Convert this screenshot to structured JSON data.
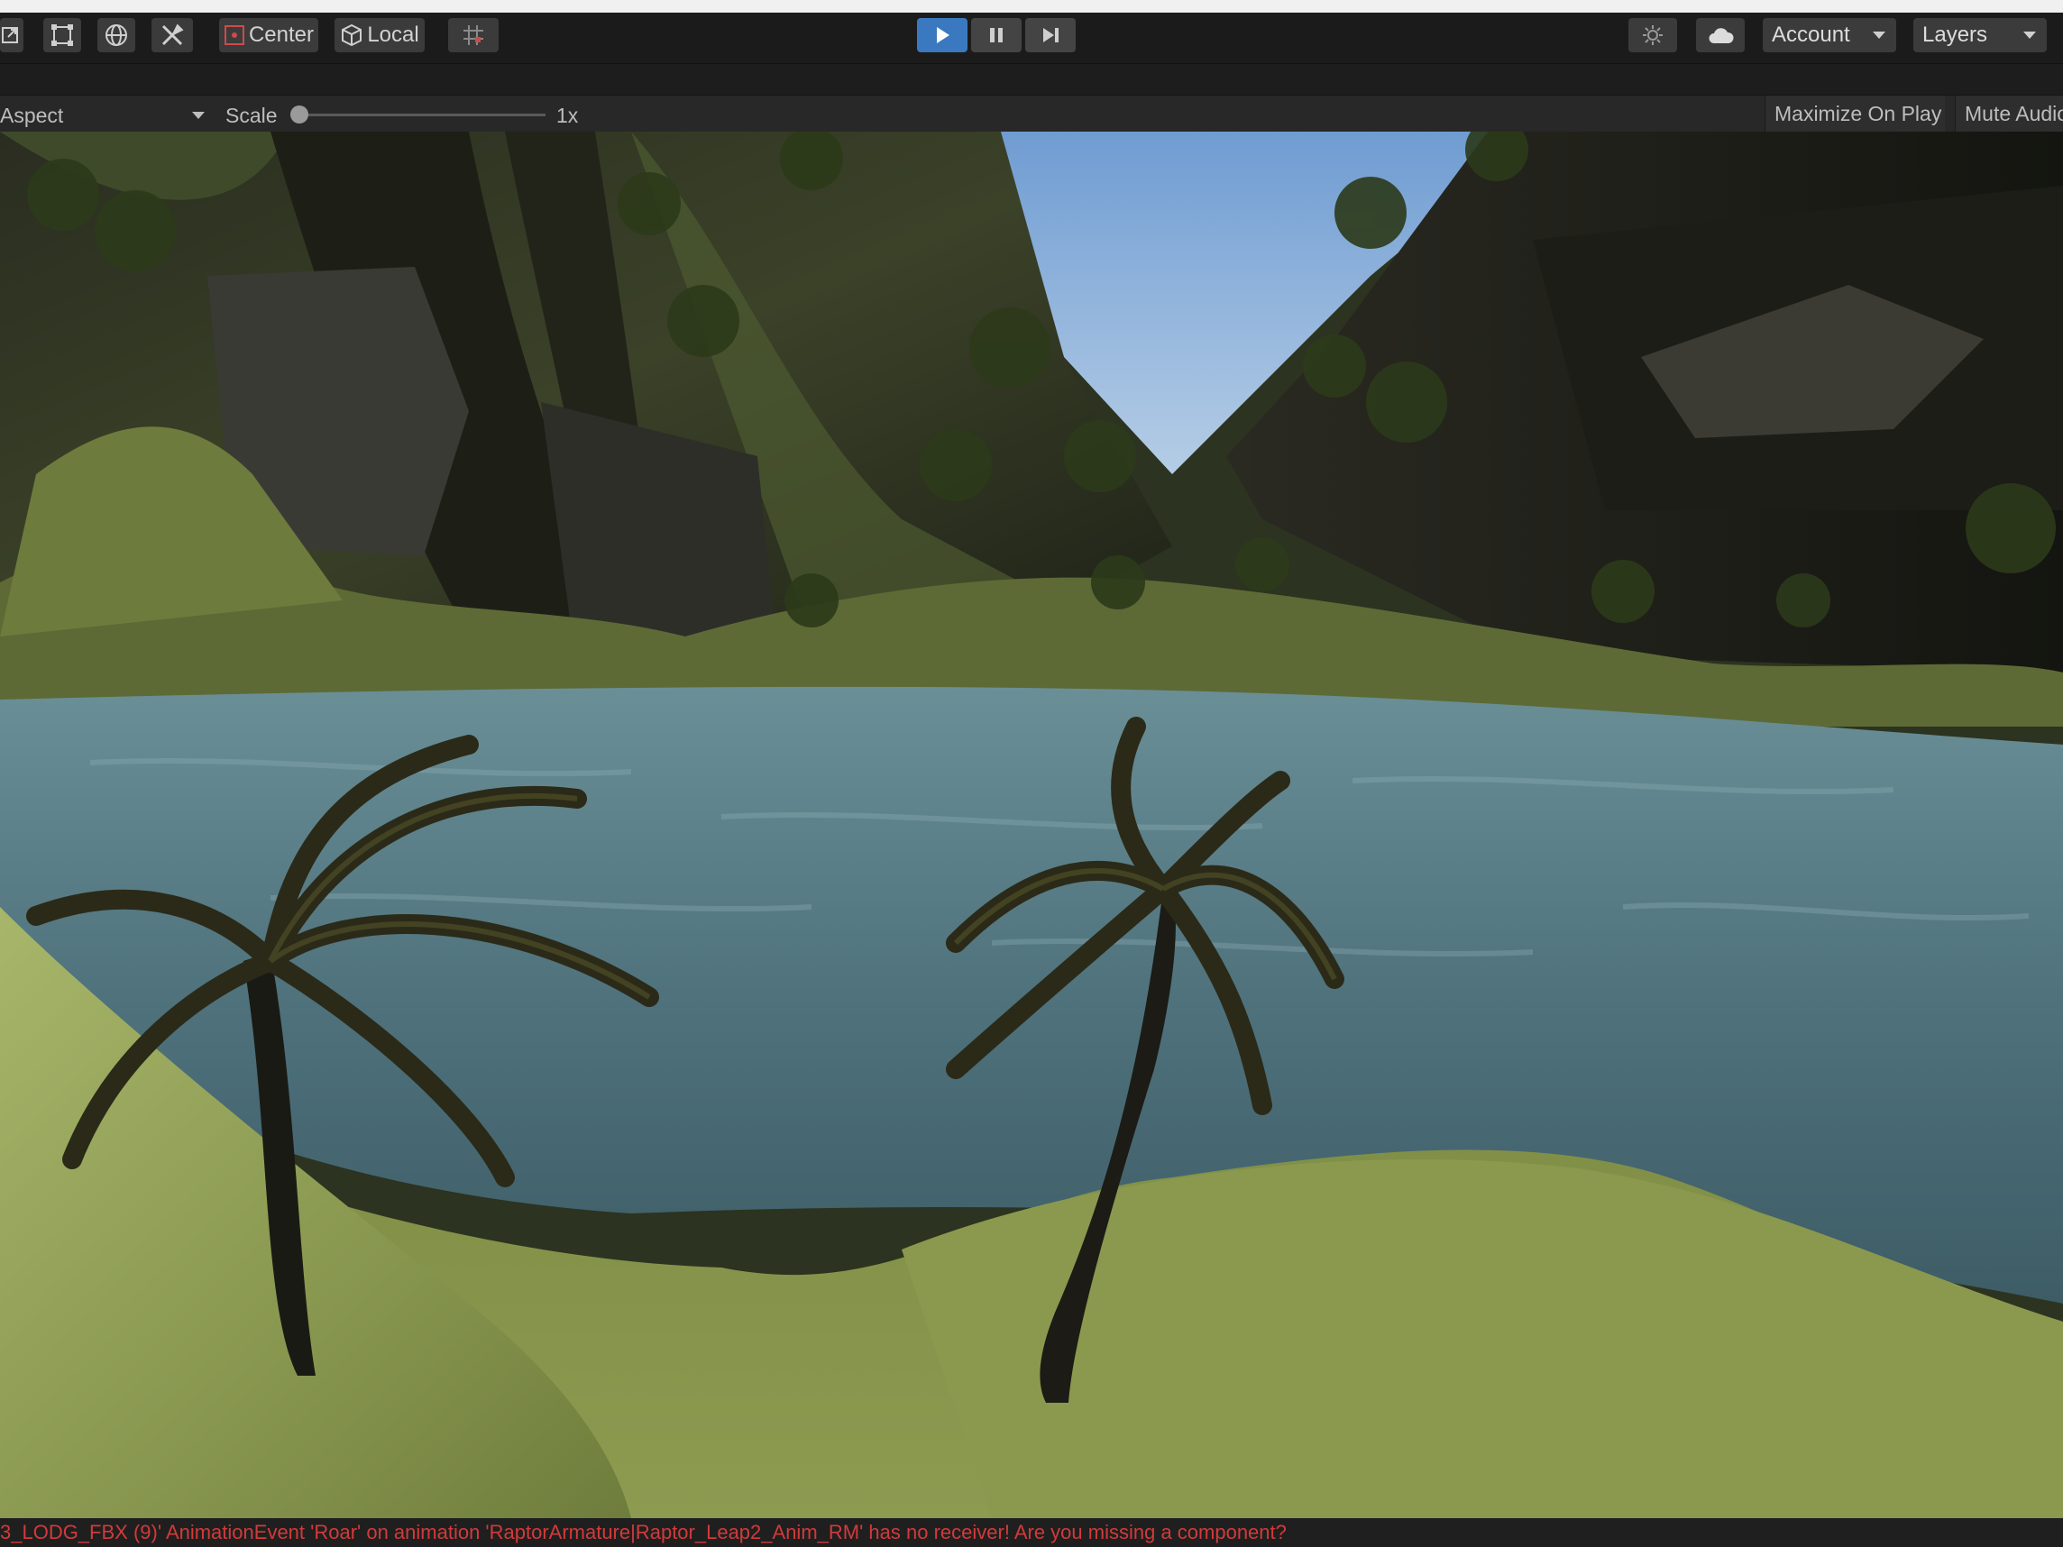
{
  "toolbar": {
    "tools": [
      {
        "name": "scale-tool-icon"
      },
      {
        "name": "rect-tool-icon"
      },
      {
        "name": "transform-tool-icon"
      },
      {
        "name": "custom-tools-icon"
      }
    ],
    "pivot_label": "Center",
    "space_label": "Local",
    "snap_icon": "grid-snap-icon",
    "playback": {
      "play_active": true
    },
    "account_label": "Account",
    "layers_label": "Layers"
  },
  "game_view": {
    "aspect_label": "Aspect",
    "scale_label": "Scale",
    "scale_value": "1x",
    "scale_slider_fraction": 0.0,
    "maximize_label": "Maximize On Play",
    "mute_label": "Mute Audio"
  },
  "console": {
    "message": "3_LODG_FBX (9)' AnimationEvent 'Roar' on animation 'RaptorArmature|Raptor_Leap2_Anim_RM' has no receiver! Are you missing a component?",
    "color": "#d23a3a"
  },
  "colors": {
    "play_accent": "#3a79bf",
    "sky": "#8fb4dc",
    "water": "#4c6f7a",
    "grass": "#8b9a52"
  }
}
